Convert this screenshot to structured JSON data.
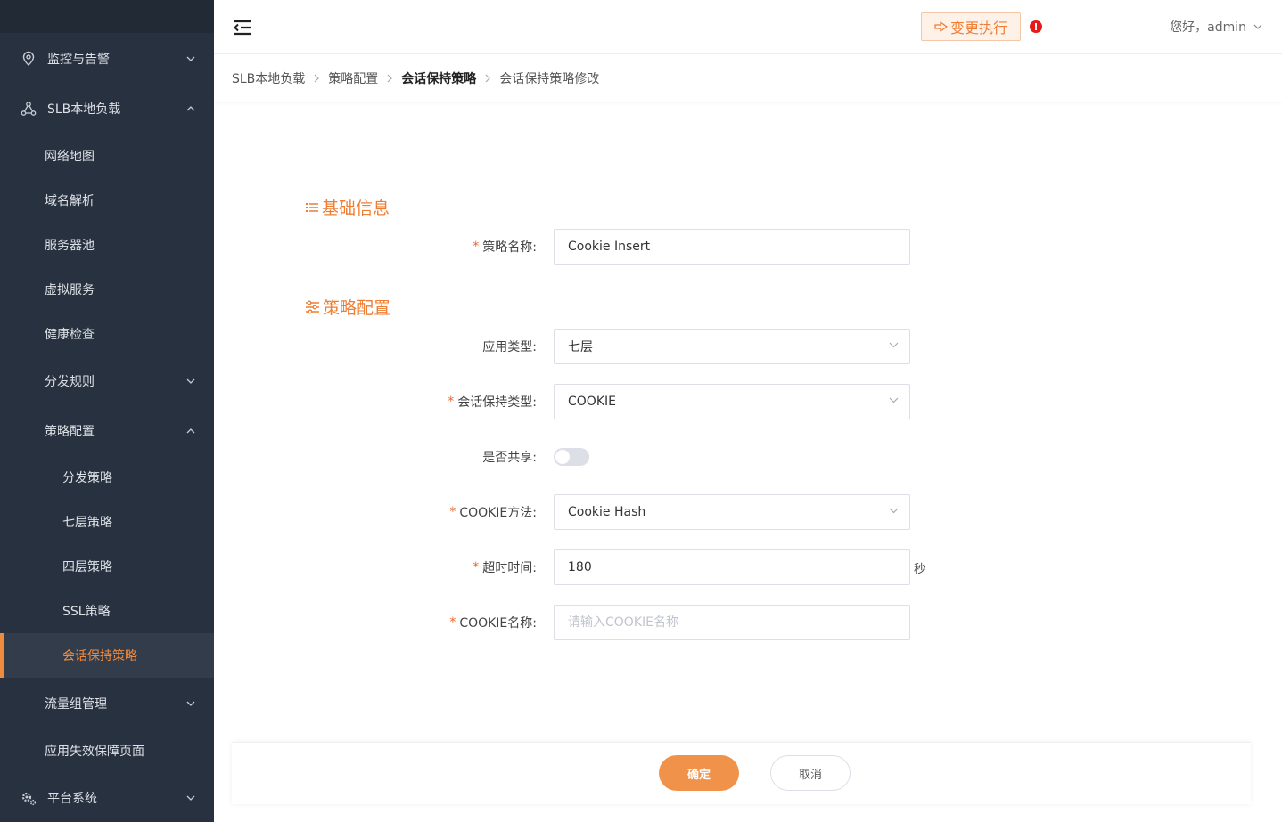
{
  "sidebar": {
    "items": [
      {
        "label": "监控与告警",
        "icon": "location-pin-icon",
        "arrow": "chevron-down"
      },
      {
        "label": "SLB本地负载",
        "icon": "network-nodes-icon",
        "arrow": "chevron-up"
      },
      {
        "label": "网络地图"
      },
      {
        "label": "域名解析"
      },
      {
        "label": "服务器池"
      },
      {
        "label": "虚拟服务"
      },
      {
        "label": "健康检查"
      },
      {
        "label": "分发规则",
        "arrow": "chevron-down"
      },
      {
        "label": "策略配置",
        "arrow": "chevron-up"
      },
      {
        "label": "分发策略"
      },
      {
        "label": "七层策略"
      },
      {
        "label": "四层策略"
      },
      {
        "label": "SSL策略"
      },
      {
        "label": "会话保持策略",
        "active": true
      },
      {
        "label": "流量组管理",
        "arrow": "chevron-down"
      },
      {
        "label": "应用失效保障页面"
      },
      {
        "label": "平台系统",
        "icon": "gears-icon",
        "arrow": "chevron-down"
      }
    ],
    "active_color": "#f08a3c"
  },
  "header": {
    "exec_button": "变更执行",
    "alert_symbol": "!",
    "user_greeting": "您好，admin"
  },
  "breadcrumb": {
    "items": [
      "SLB本地负载",
      "策略配置",
      "会话保持策略",
      "会话保持策略修改"
    ]
  },
  "sections": {
    "basic": "基础信息",
    "policy": "策略配置"
  },
  "form": {
    "policy_name": {
      "label": "策略名称:",
      "value": "Cookie Insert"
    },
    "app_type": {
      "label": "应用类型:",
      "value": "七层"
    },
    "session_type": {
      "label": "会话保持类型:",
      "value": "COOKIE"
    },
    "shared": {
      "label": "是否共享:",
      "on": false
    },
    "cookie_method": {
      "label": "COOKIE方法:",
      "value": "Cookie Hash"
    },
    "timeout": {
      "label": "超时时间:",
      "value": "180",
      "suffix": "秒"
    },
    "cookie_name": {
      "label": "COOKIE名称:",
      "value": "",
      "placeholder": "请输入COOKIE名称"
    }
  },
  "footer": {
    "confirm": "确定",
    "cancel": "取消"
  },
  "colors": {
    "accent": "#ef7d33",
    "sidebar_bg": "#28313f",
    "required": "#f0632b"
  }
}
